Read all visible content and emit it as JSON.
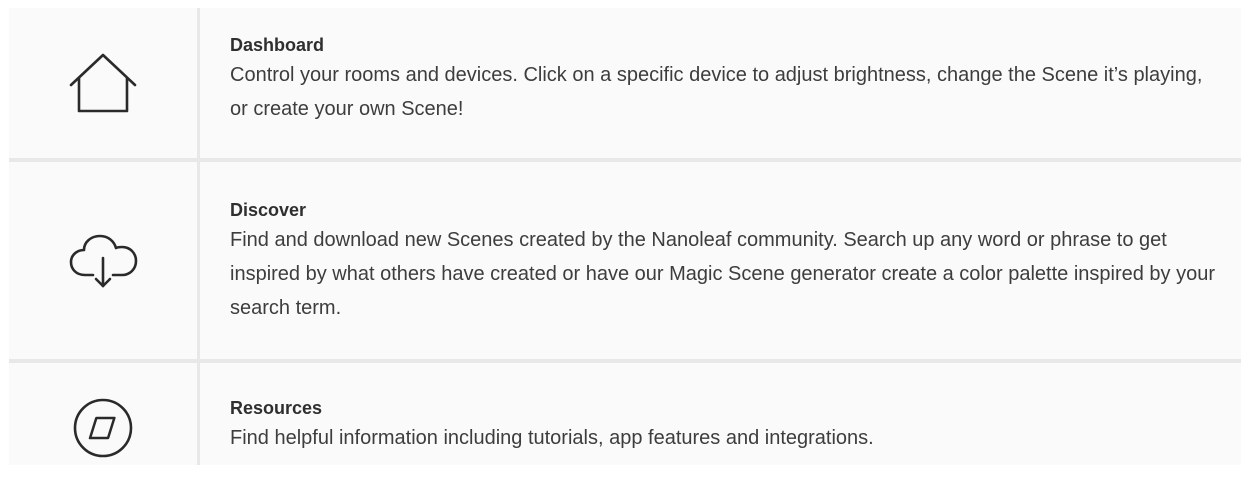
{
  "rows": [
    {
      "icon": "home-icon",
      "title": "Dashboard",
      "description": "Control your rooms and devices. Click on a specific device to adjust brightness, change the Scene it’s playing, or create your own Scene!"
    },
    {
      "icon": "cloud-download-icon",
      "title": "Discover",
      "description": "Find and download new Scenes created by the Nanoleaf community. Search up any word or phrase to get inspired by what others have created or have our Magic Scene generator create a color palette inspired by your search term."
    },
    {
      "icon": "compass-icon",
      "title": "Resources",
      "description": "Find helpful information including tutorials, app features and  integrations."
    }
  ],
  "colors": {
    "background": "#ffffff",
    "cell": "#fafafa",
    "grid_line": "#e8e8e8",
    "text": "#3d3d3d",
    "icon_stroke": "#2a2a2a"
  }
}
